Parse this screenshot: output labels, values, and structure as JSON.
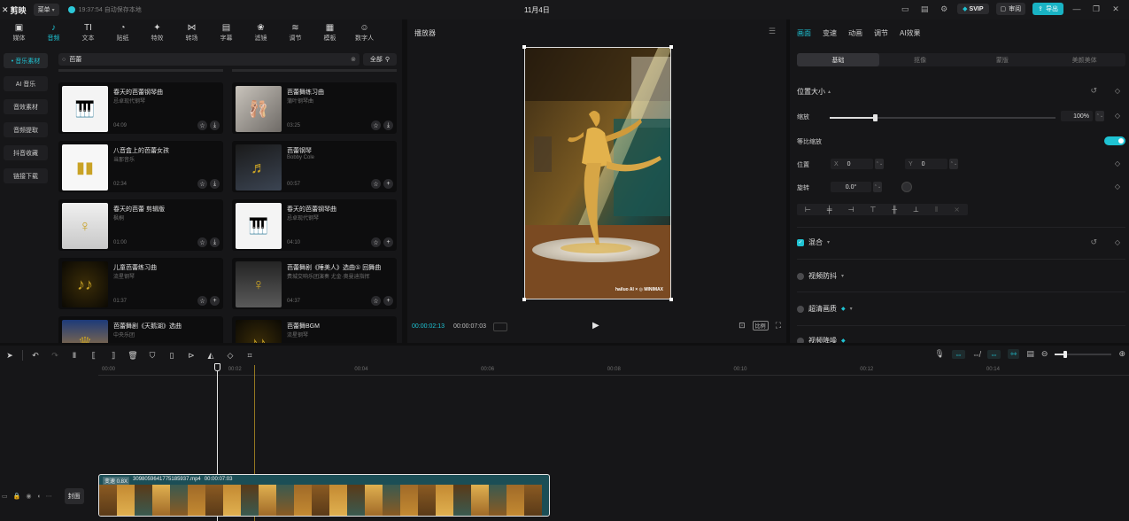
{
  "app": {
    "logo_text": "剪映",
    "menu_label": "菜单",
    "save_status": "19:37:54 自动保存本地",
    "project_title": "11月4日",
    "svip_label": "SVIP",
    "review_label": "审阅",
    "export_label": "导出"
  },
  "categories": [
    {
      "label": "媒体",
      "icon": "▣"
    },
    {
      "label": "音频",
      "icon": "♪"
    },
    {
      "label": "文本",
      "icon": "TI"
    },
    {
      "label": "贴纸",
      "icon": "◔"
    },
    {
      "label": "特效",
      "icon": "✦"
    },
    {
      "label": "转场",
      "icon": "⋈"
    },
    {
      "label": "字幕",
      "icon": "▤"
    },
    {
      "label": "滤镜",
      "icon": "❀"
    },
    {
      "label": "调节",
      "icon": "≋"
    },
    {
      "label": "模板",
      "icon": "▦"
    },
    {
      "label": "数字人",
      "icon": "☺"
    }
  ],
  "sidenav": [
    "• 音乐素材",
    "AI 音乐",
    "音效素材",
    "音频提取",
    "抖音收藏",
    "链接下载"
  ],
  "search": {
    "query": "芭蕾",
    "filter_label": "全部"
  },
  "tracks": [
    {
      "title": "春天的芭蕾钢琴曲",
      "artist": "忌卓现代钢琴",
      "duration": "04:09",
      "action": "download"
    },
    {
      "title": "芭蕾舞练习曲",
      "artist": "蒲叶钢琴曲",
      "duration": "03:25",
      "action": "download"
    },
    {
      "title": "八音盒上的芭蕾女孩",
      "artist": "当那音乐",
      "duration": "02:34",
      "action": "download"
    },
    {
      "title": "芭蕾钢琴",
      "artist": "Bobby Cole",
      "duration": "00:57",
      "action": "add"
    },
    {
      "title": "春天的芭蕾 剪辑版",
      "artist": "枫桐",
      "duration": "01:00",
      "action": "download"
    },
    {
      "title": "春天的芭蕾钢琴曲",
      "artist": "忌卓现代钢琴",
      "duration": "04:10",
      "action": "add"
    },
    {
      "title": "儿童芭蕾练习曲",
      "artist": "流星钢琴",
      "duration": "01:37",
      "action": "add"
    },
    {
      "title": "芭蕾舞剧《睡美人》选曲① 回舞曲",
      "artist": "费城交响乐团演奏 尤金·奥曼迪指挥",
      "duration": "04:37",
      "action": "add"
    },
    {
      "title": "芭蕾舞剧《天鹅湖》选曲",
      "artist": "中央乐团",
      "duration": "",
      "action": "add"
    },
    {
      "title": "芭蕾舞BGM",
      "artist": "流星钢琴",
      "duration": "",
      "action": "add"
    }
  ],
  "player": {
    "title": "播放器",
    "current_time": "00:00:02:13",
    "total_time": "00:00:07:03",
    "watermark": "hailuo AI × ◎ MINIMAX",
    "ratio_label": "比例"
  },
  "inspector": {
    "tabs": [
      "画面",
      "变速",
      "动画",
      "调节",
      "AI效果"
    ],
    "subtabs": [
      "基础",
      "抠像",
      "蒙版",
      "美颜美体"
    ],
    "position_size_label": "位置大小",
    "scale_label": "缩放",
    "scale_value": "100%",
    "scale_fraction": 0.2,
    "uniform_scale_label": "等比缩放",
    "position_label": "位置",
    "pos_x_label": "X",
    "pos_x": "0",
    "pos_y_label": "Y",
    "pos_y": "0",
    "rotate_label": "旋转",
    "rotate_value": "0.0°",
    "blend_label": "混合",
    "stabilize_label": "视频防抖",
    "super_res_label": "超清画质",
    "denoise_label": "视频降噪"
  },
  "timeline": {
    "ruler": [
      "00:00",
      "00:02",
      "00:04",
      "00:06",
      "00:08",
      "00:10",
      "00:12",
      "00:14"
    ],
    "clip_speed": "变速 0.8X",
    "clip_name": "3098059641775185937.mp4",
    "clip_duration": "00:00:07:03",
    "cover_label": "封面"
  },
  "colors": {
    "accent": "#1fc3d3",
    "clip_bg": "#1b4e56",
    "marker": "#c9a225"
  }
}
